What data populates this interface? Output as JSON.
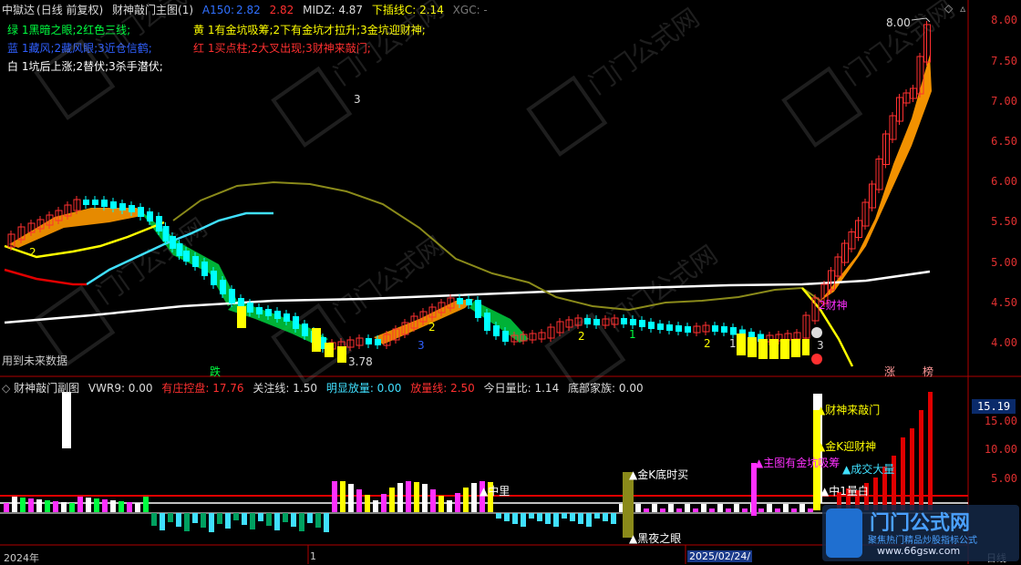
{
  "main_header": {
    "app": "中獄达",
    "period": "(日线 前复权)",
    "indicator": "财神敲门主图(1)",
    "a150_label": "A150:",
    "a150_v1": "2.82",
    "a150_v2": "2.82",
    "midz": "MIDZ: 4.87",
    "lower": "下插线C: 2.14",
    "xgc": "XGC: -"
  },
  "legend": {
    "green": "绿 1黑暗之眼;2红色三线;",
    "blue": "蓝 1藏风;2藏风眼;3近仓信鹤;",
    "white": "白 1坑后上涨;2替伏;3杀手潜伏;",
    "yellow": "黄 1有金坑吸筹;2下有金坑才拉升;3金坑迎财神;",
    "red": "红 1买点柱;2大叉出现;3财神来敲门;"
  },
  "main_y_ticks": [
    "8.00",
    "7.50",
    "7.00",
    "6.50",
    "6.00",
    "5.50",
    "5.00",
    "4.50",
    "4.00"
  ],
  "main_annotations": {
    "future_data": "用到未来数据",
    "low_price": "3.78",
    "high_price": "8.00",
    "caishen": "2财神",
    "die": "跌",
    "zhang": "涨",
    "bang": "榜",
    "n3a": "3",
    "n2a": "2",
    "n2b": "2",
    "n3b": "3",
    "n2c": "2",
    "n1a": "1",
    "n2d": "2",
    "n1b": "1",
    "n3c": "3"
  },
  "sub_header": {
    "name": "财神敲门副图",
    "vwr": "VWR9: 0.00",
    "zhuang": "有庄控盘: 17.76",
    "focus": "关注线: 1.50",
    "vol_up": "明显放量: 0.00",
    "vol_line": "放量线: 2.50",
    "ratio": "今日量比: 1.14",
    "bottom": "底部家族: 0.00"
  },
  "sub_y_ticks": [
    "15.00",
    "10.00",
    "5.00"
  ],
  "sub_value_badge": "15.19",
  "sub_annotations": {
    "jink_dishi": "金K底时买",
    "heiye": "黑夜之眼",
    "zhongliang1": "中里",
    "zhongliang2": "中1量白",
    "caishen_door": "财神来敲门",
    "jink_caishen": "金K迎财神",
    "zhutu": "主图有金坑吸筹",
    "chengjiao": "成交大量"
  },
  "time_axis": {
    "year_label": "2024年",
    "date_label": "2025/02/24/",
    "bottom_right": "日线",
    "tick_1": "1"
  },
  "watermark": {
    "site": "www.66gsw.com",
    "brand": "门门公式网",
    "slogan": "聚焦热门精品炒股指标公式"
  },
  "colors": {
    "up": "#ff3030",
    "down": "#00ffff",
    "green_ma": "#00ff40",
    "yellow": "#ffff00",
    "olive": "#8a8a1a",
    "red_line": "#e00000",
    "white": "#ffffff",
    "orange": "#ff9900"
  }
}
